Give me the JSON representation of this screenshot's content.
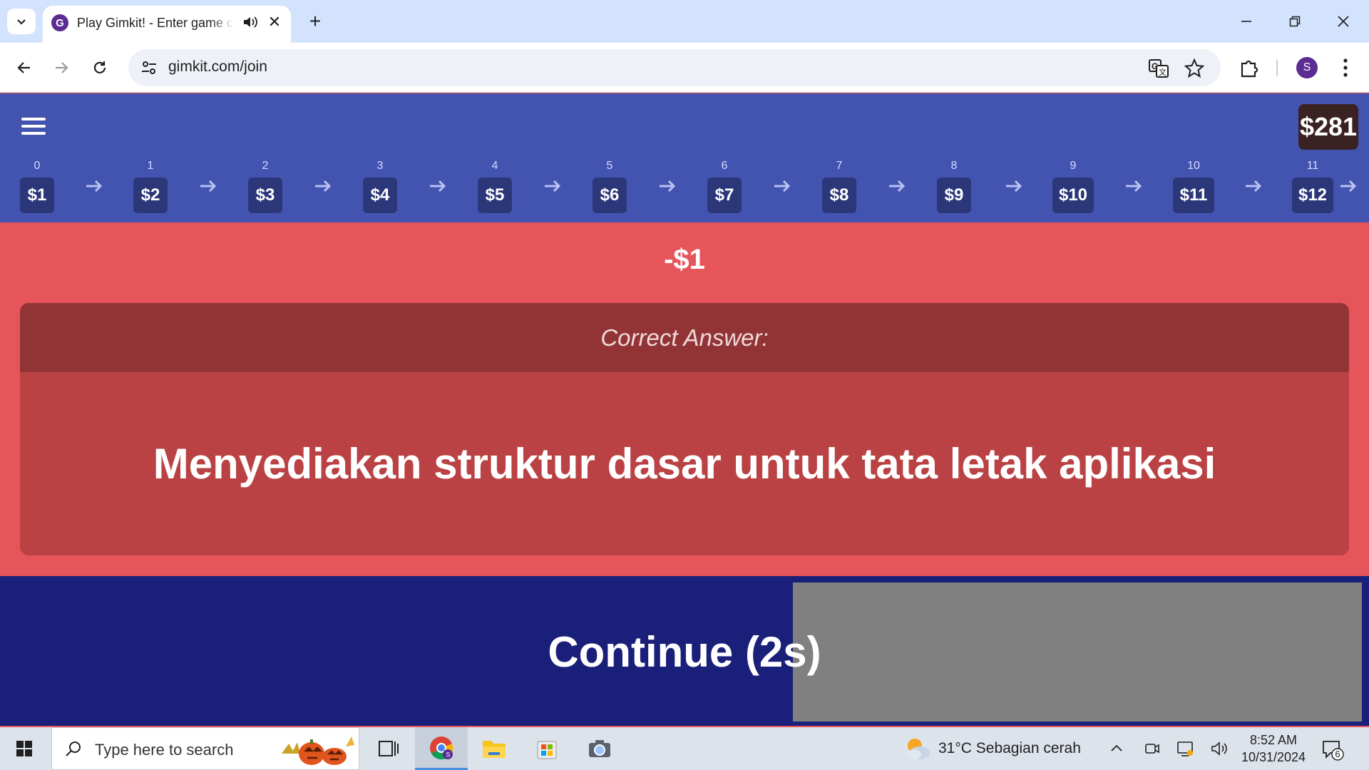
{
  "browser": {
    "tab_title": "Play Gimkit! - Enter game code",
    "favicon_letter": "G",
    "url": "gimkit.com/join",
    "profile_initial": "S",
    "new_tab": "+",
    "close_tab": "✕"
  },
  "game": {
    "balance": "$281",
    "delta": "-$1",
    "levels": [
      {
        "index": "0",
        "value": "$1"
      },
      {
        "index": "1",
        "value": "$2"
      },
      {
        "index": "2",
        "value": "$3"
      },
      {
        "index": "3",
        "value": "$4"
      },
      {
        "index": "4",
        "value": "$5"
      },
      {
        "index": "5",
        "value": "$6"
      },
      {
        "index": "6",
        "value": "$7"
      },
      {
        "index": "7",
        "value": "$8"
      },
      {
        "index": "8",
        "value": "$9"
      },
      {
        "index": "9",
        "value": "$10"
      },
      {
        "index": "10",
        "value": "$11"
      },
      {
        "index": "11",
        "value": "$12"
      }
    ],
    "correct_answer_label": "Correct Answer:",
    "correct_answer": "Menyediakan struktur dasar untuk tata letak aplikasi",
    "continue_label": "Continue (2s)",
    "continue_progress": 0.58
  },
  "taskbar": {
    "search_placeholder": "Type here to search",
    "weather": "31°C  Sebagian cerah",
    "time": "8:52 AM",
    "date": "10/31/2024",
    "notification_count": "6"
  },
  "colors": {
    "header": "#4353b0",
    "feedback_bg": "#e5555a",
    "answer_card": "#ba4244",
    "continue_fill": "#1a1f7a",
    "balance_bg": "#3a2222"
  }
}
